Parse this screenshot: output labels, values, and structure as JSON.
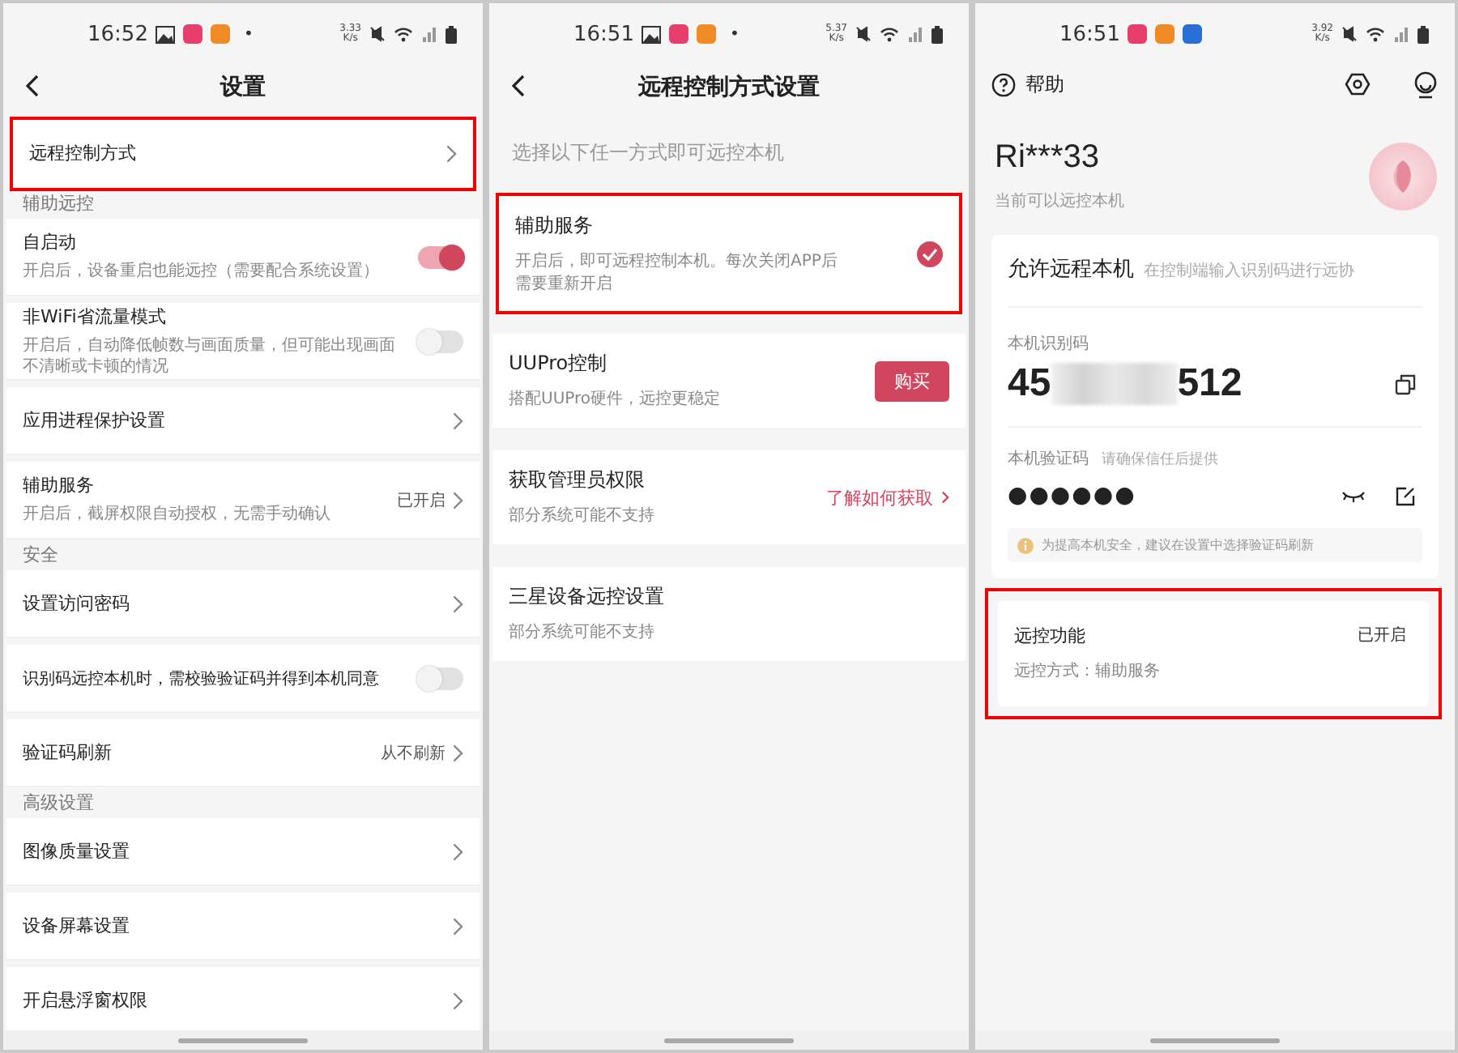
{
  "left_screen": {
    "status": {
      "time": "16:52",
      "apps": [
        {
          "kind": "image"
        },
        {
          "kind": "pink"
        },
        {
          "kind": "orange"
        }
      ],
      "dot": "•",
      "speed": "3.33",
      "speed_unit": "K/s"
    },
    "title": "设置",
    "items": [
      {
        "kind": "link",
        "label": "远程控制方式",
        "highlighted": true
      },
      {
        "kind": "section",
        "label": "辅助远控"
      },
      {
        "kind": "toggle",
        "label": "自启动",
        "note": "开启后，设备重启也能远控（需要配合系统设置）",
        "on": true,
        "highlighted": false
      },
      {
        "kind": "toggle",
        "label": "非WiFi省流量模式",
        "note": "开启后，自动降低帧数与画面质量，但可能出现画面不清晰或卡顿的情况",
        "on": false,
        "highlighted": false
      },
      {
        "kind": "link",
        "label": "应用进程保护设置",
        "highlighted": false
      },
      {
        "kind": "link",
        "label": "辅助服务",
        "note": "开启后，截屏权限自动授权，无需手动确认",
        "value": "已开启",
        "highlighted": false
      },
      {
        "kind": "section",
        "label": "安全"
      },
      {
        "kind": "link",
        "label": "设置访问密码",
        "highlighted": false
      },
      {
        "kind": "toggle",
        "label": "识别码远控本机时，需校验验证码并得到本机同意",
        "on": false,
        "highlighted": false
      },
      {
        "kind": "link",
        "label": "验证码刷新",
        "value": "从不刷新",
        "highlighted": false
      },
      {
        "kind": "section",
        "label": "高级设置"
      },
      {
        "kind": "link",
        "label": "图像质量设置",
        "highlighted": false
      },
      {
        "kind": "link",
        "label": "设备屏幕设置",
        "highlighted": false
      },
      {
        "kind": "link",
        "label": "开启悬浮窗权限",
        "highlighted": false
      }
    ]
  },
  "middle_screen": {
    "status": {
      "time": "16:51",
      "apps": [
        {
          "kind": "image"
        },
        {
          "kind": "pink"
        },
        {
          "kind": "orange"
        }
      ],
      "dot": "•",
      "speed": "5.37",
      "speed_unit": "K/s"
    },
    "title": "远程控制方式设置",
    "prompt": "选择以下任一方式即可远控本机",
    "options": [
      {
        "kind": "check",
        "label": "辅助服务",
        "note": "开启后，即可远程控制本机。每次关闭APP后需要重新开启",
        "checked": true,
        "highlighted": true
      },
      {
        "kind": "button",
        "label": "UUPro控制",
        "note": "搭配UUPro硬件，远控更稳定",
        "action": "购买",
        "highlighted": false
      },
      {
        "kind": "link",
        "label": "获取管理员权限",
        "note": "部分系统可能不支持",
        "action": "了解如何获取",
        "highlighted": false
      },
      {
        "kind": "plain",
        "label": "三星设备远控设置",
        "note": "部分系统可能不支持",
        "highlighted": false
      }
    ]
  },
  "right_screen": {
    "status": {
      "time": "16:51",
      "apps": [
        {
          "kind": "pink"
        },
        {
          "kind": "orange"
        },
        {
          "kind": "blue"
        }
      ],
      "speed": "3.92",
      "speed_unit": "K/s"
    },
    "help": "帮助",
    "user": "Ri***33",
    "user_status": "当前可以远控本机",
    "card": {
      "title": "允许远程本机",
      "hint": "在控制端输入识别码进行远协",
      "code_label": "本机识别码",
      "code_start": "45",
      "code_end": "512",
      "verify_label": "本机验证码",
      "verify_hint": "请确保信任后提供",
      "verify_dots": "●●●●●●",
      "notice": "为提高本机安全，建议在设置中选择验证码刷新"
    },
    "remote": {
      "title": "远控功能",
      "state": "已开启",
      "note": "远控方式：辅助服务",
      "highlighted": true
    }
  }
}
